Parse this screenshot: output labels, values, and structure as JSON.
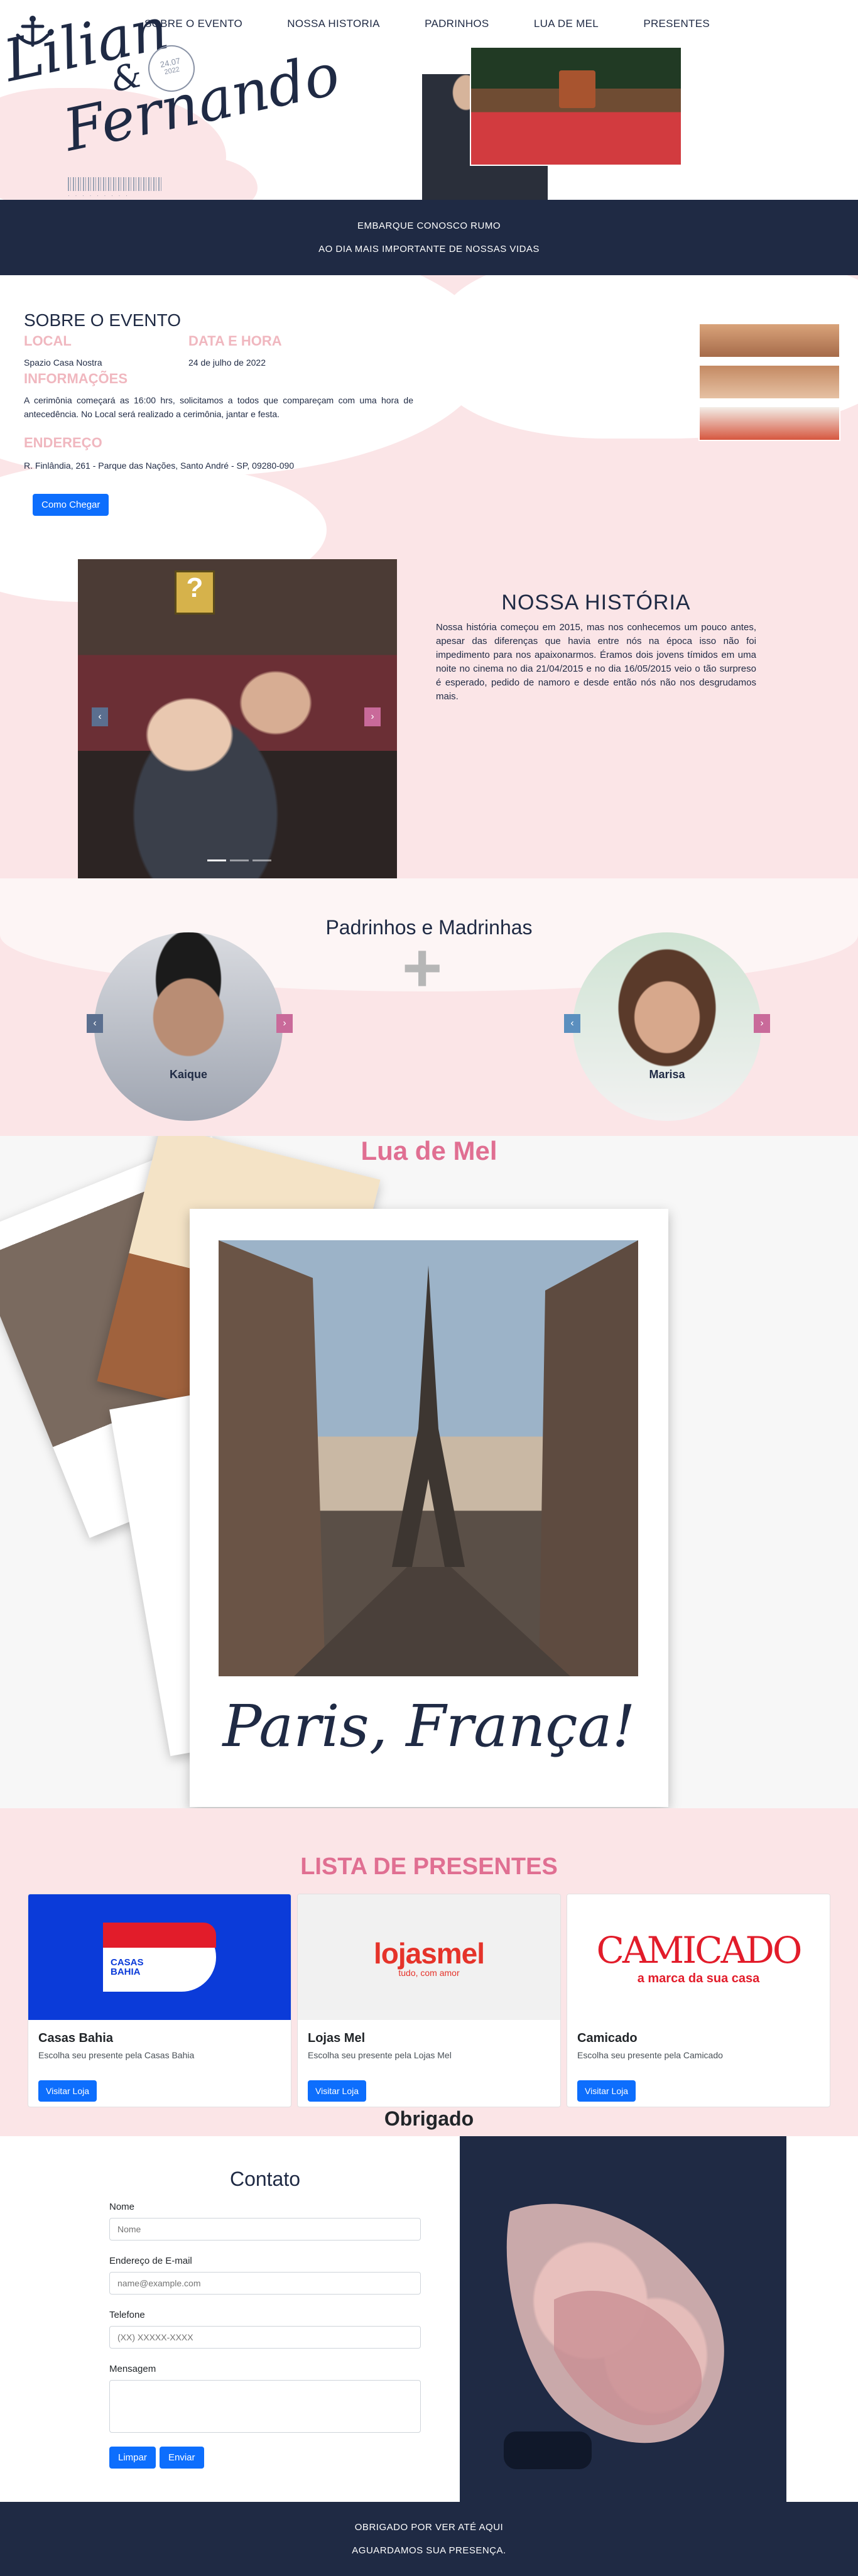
{
  "nav": {
    "items": [
      "SOBRE O EVENTO",
      "NOSSA HISTORIA",
      "PADRINHOS",
      "LUA DE MEL",
      "PRESENTES"
    ]
  },
  "header": {
    "name_first": "Lilian",
    "ampersand": "&",
    "name_second": "Fernando",
    "stamp_date": "24.07",
    "stamp_year": "2022"
  },
  "banner": {
    "line1": "EMBARQUE CONOSCO RUMO",
    "line2": "AO DIA MAIS IMPORTANTE DE NOSSAS VIDAS"
  },
  "sobre": {
    "title": "SOBRE O EVENTO",
    "local_label": "LOCAL",
    "local_value": "Spazio Casa Nostra",
    "data_label": "DATA E HORA",
    "data_value": "24 de julho de 2022",
    "info_label": "INFORMAÇÕES",
    "info_text": "A cerimônia começará as 16:00 hrs, solicitamos a todos que compareçam com uma hora de antecedência. No Local será realizado a cerimônia, jantar e festa.",
    "endereco_label": "ENDEREÇO",
    "endereco_value": "R. Finlândia, 261 - Parque das Nações, Santo André - SP, 09280-090",
    "button": "Como Chegar"
  },
  "historia": {
    "title": "NOSSA HISTÓRIA",
    "text": "Nossa história começou em 2015, mas nos conhecemos um pouco antes, apesar das diferenças que havia entre nós na época isso não foi impedimento para nos apaixonarmos. Éramos dois jovens tímidos em uma noite no cinema no dia 21/04/2015 e no dia 16/05/2015 veio o tão surpreso é esperado, pedido de namoro e desde então nós não nos desgrudamos mais.",
    "prev_icon": "chevron-left-icon",
    "next_icon": "chevron-right-icon"
  },
  "padrinhos": {
    "title": "Padrinhos e Madrinhas",
    "padrinho_name": "Kaique",
    "madrinha_name": "Marisa"
  },
  "lua_de_mel": {
    "title": "Lua de Mel",
    "caption": "Paris, França!"
  },
  "presentes": {
    "title": "LISTA DE PRESENTES",
    "stores": [
      {
        "name": "Casas Bahia",
        "desc": "Escolha seu presente pela Casas Bahia",
        "button": "Visitar Loja",
        "logo_top": "CASAS",
        "logo_bottom": "BAHIA"
      },
      {
        "name": "Lojas Mel",
        "desc": "Escolha seu presente pela Lojas Mel",
        "button": "Visitar Loja",
        "logo": "lojasmel",
        "tagline": "tudo, com amor"
      },
      {
        "name": "Camicado",
        "desc": "Escolha seu presente pela Camicado",
        "button": "Visitar Loja",
        "logo": "CAMICADO",
        "tagline": "a marca da sua casa"
      }
    ],
    "thanks": "Obrigado"
  },
  "contato": {
    "title": "Contato",
    "nome_label": "Nome",
    "nome_placeholder": "Nome",
    "email_label": "Endereço de E-mail",
    "email_placeholder": "name@example.com",
    "telefone_label": "Telefone",
    "telefone_placeholder": "(XX) XXXXX-XXXX",
    "mensagem_label": "Mensagem",
    "limpar": "Limpar",
    "enviar": "Enviar"
  },
  "footer": {
    "line1": "OBRIGADO POR VER ATÉ AQUI",
    "line2": "AGUARDAMOS SUA PRESENÇA."
  },
  "colors": {
    "navy": "#1f2a44",
    "pink_bg": "#fbe5e7",
    "accent_pink": "#e06f92",
    "button_blue": "#0d6efd"
  }
}
